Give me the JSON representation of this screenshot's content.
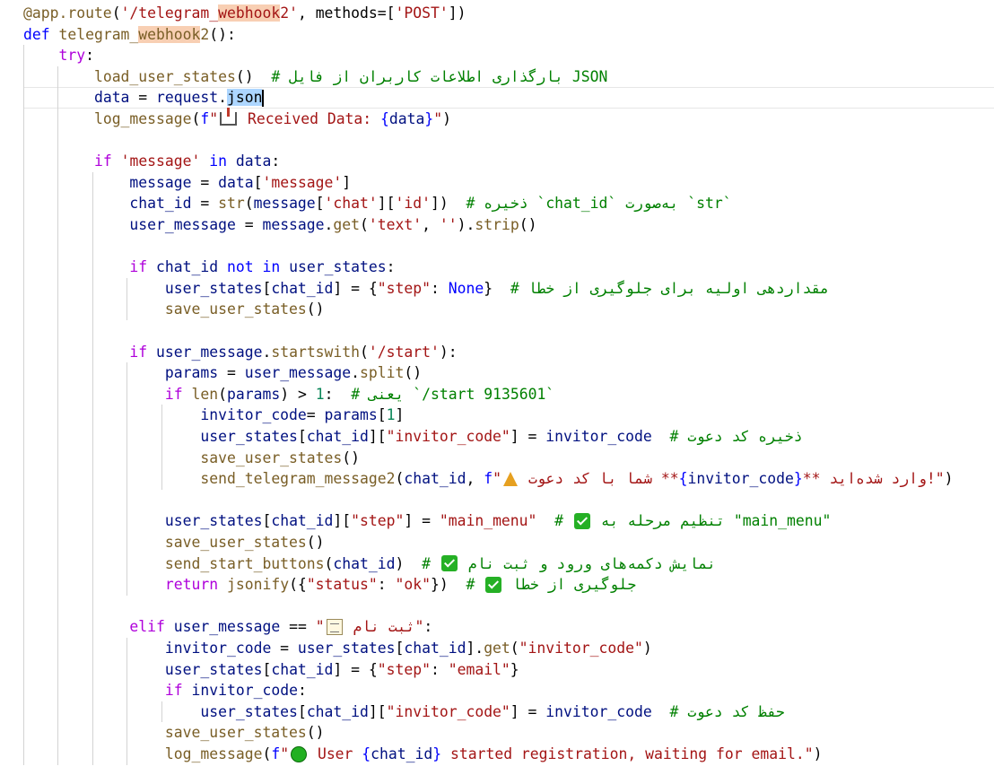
{
  "editor": {
    "lines": [
      "@app.route('/telegram_webhook2', methods=['POST'])",
      "def telegram_webhook2():",
      "    try:",
      "        load_user_states()  # بارگذاری اطلاعات کاربران از فایل JSON",
      "        data = request.json",
      "        log_message(f\"📥 Received Data: {data}\")",
      "",
      "        if 'message' in data:",
      "            message = data['message']",
      "            chat_id = str(message['chat']['id'])  # ذخیره `chat_id` به‌صورت `str`",
      "            user_message = message.get('text', '').strip()",
      "",
      "            if chat_id not in user_states:",
      "                user_states[chat_id] = {\"step\": None}  # مقداردهی اولیه برای جلوگیری از خطا",
      "                save_user_states()",
      "",
      "            if user_message.startswith('/start'):",
      "                params = user_message.split()",
      "                if len(params) > 1:  # یعنی `/start 9135601`",
      "                    invitor_code= params[1]",
      "                    user_states[chat_id][\"invitor_code\"] = invitor_code  # ذخیره کد دعوت",
      "                    save_user_states()",
      "                    send_telegram_message2(chat_id, f\"🎉 شما با کد دعوت **{invitor_code}** وارد شده‌اید!\")",
      "",
      "                user_states[chat_id][\"step\"] = \"main_menu\"  # ✅ تنظیم مرحله به \"main_menu\"",
      "                save_user_states()",
      "                send_start_buttons(chat_id)  # ✅ نمایش دکمه‌های ورود و ثبت نام",
      "                return jsonify({\"status\": \"ok\"})  # ✅ جلوگیری از خطا",
      "",
      "            elif user_message == \"📝 ثبت نام\":",
      "                invitor_code = user_states[chat_id].get(\"invitor_code\")",
      "                user_states[chat_id] = {\"step\": \"email\"}",
      "                if invitor_code:",
      "                    user_states[chat_id][\"invitor_code\"] = invitor_code  # حفظ کد دعوت",
      "                save_user_states()",
      "                log_message(f\"🟢 User {chat_id} started registration, waiting for email.\")"
    ],
    "highlight_term": "webhook",
    "selected_word": "json",
    "colors": {
      "keyword": "#0000ff",
      "control_flow": "#af00db",
      "function": "#795e26",
      "string": "#a31515",
      "variable": "#001080",
      "comment": "#008000",
      "number": "#098658",
      "search_highlight": "#f8cfb3",
      "selection": "#add6ff",
      "background": "#ffffff"
    }
  }
}
